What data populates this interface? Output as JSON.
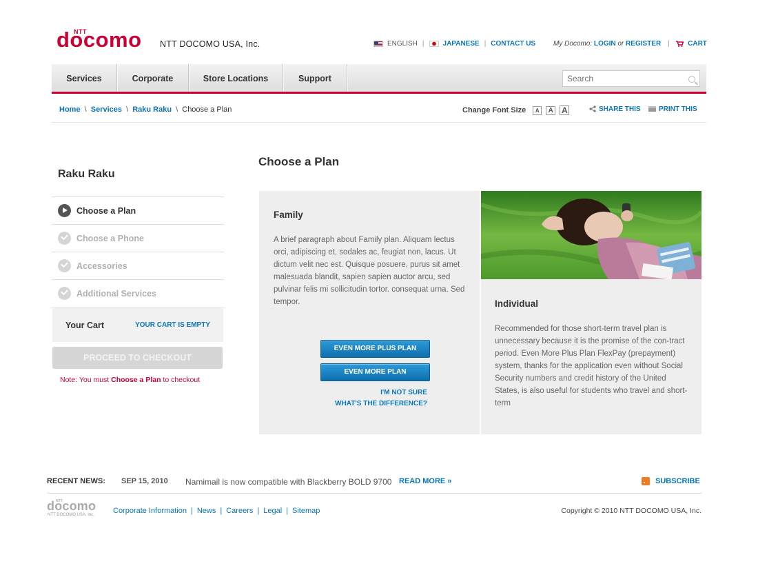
{
  "header": {
    "logo_ntt": "NTT",
    "logo_word": "docomo",
    "company": "NTT DOCOMO USA, Inc.",
    "languages": [
      "ENGLISH",
      "JAPANESE"
    ],
    "contact": "CONTACT US",
    "my_docomo_label": "My Docomo:",
    "login": "LOGIN",
    "or": "or",
    "register": "REGISTER",
    "cart": "CART"
  },
  "nav": {
    "items": [
      "Services",
      "Corporate",
      "Store Locations",
      "Support"
    ],
    "search_placeholder": "Search"
  },
  "breadcrumb": {
    "links": [
      "Home",
      "Services",
      "Raku Raku"
    ],
    "separator": "\\",
    "current": "Choose a Plan",
    "font_size_label": "Change Font Size",
    "font_size_options": [
      "A",
      "A",
      "A"
    ],
    "share": "SHARE THIS",
    "print": "PRINT THIS"
  },
  "sidebar": {
    "title": "Raku Raku",
    "steps": [
      {
        "label": "Choose a Plan",
        "state": "active"
      },
      {
        "label": "Choose a Phone",
        "state": "inactive"
      },
      {
        "label": "Accessories",
        "state": "inactive"
      },
      {
        "label": "Additional Services",
        "state": "inactive"
      }
    ],
    "cart_label": "Your Cart",
    "cart_status": "YOUR CART IS EMPTY",
    "checkout": "PROCEED TO CHECKOUT",
    "note_prefix": "Note: You must ",
    "note_bold": "Choose a Plan",
    "note_suffix": " to checkout"
  },
  "main": {
    "title": "Choose a Plan",
    "family": {
      "title": "Family",
      "description": "A brief paragraph about Family plan. Aliquam lectus orci, adipiscing et, sodales ac, feugiat non, lacus. Ut dictum velit nec est. Quisque posuere, purus sit amet malesuada blandit, sapien sapien auctor arcu, sed pulvinar felis mi sollicitudin tortor. consequat urna. Sed tempor.",
      "buttons": [
        "EVEN MORE PLUS PLAN",
        "EVEN MORE PLAN"
      ],
      "not_sure": "I'M NOT SURE",
      "difference": "WHAT'S THE DIFFERENCE?"
    },
    "individual": {
      "title": "Individual",
      "description": "Recommended for those short-term travel plan is unnecessary because it is the promise of the con-tract period. Even More Plus Plan FlexPay (prepayment) system, thanks for the application even without Social Security numbers and credit history of the United States, is also useful for students who travel and short-term"
    }
  },
  "footer": {
    "news_label": "RECENT NEWS:",
    "news_date": "SEP 15, 2010",
    "news_text": "Namimail is now compatible with Blackberry BOLD 9700",
    "read_more": "READ MORE »",
    "subscribe": "SUBSCRIBE",
    "logo_ntt": "NTT",
    "logo_word": "docomo",
    "logo_company": "NTT DOCOMO USA, Inc.",
    "links": [
      "Corporate Information",
      "News",
      "Careers",
      "Legal",
      "Sitemap"
    ],
    "copyright": "Copyright © 2010 NTT DOCOMO USA, Inc."
  },
  "colors": {
    "brand_red": "#cc0033",
    "link_blue": "#0a76b7",
    "button_blue": "#1a86c8",
    "panel_gray": "#eeeeee"
  }
}
